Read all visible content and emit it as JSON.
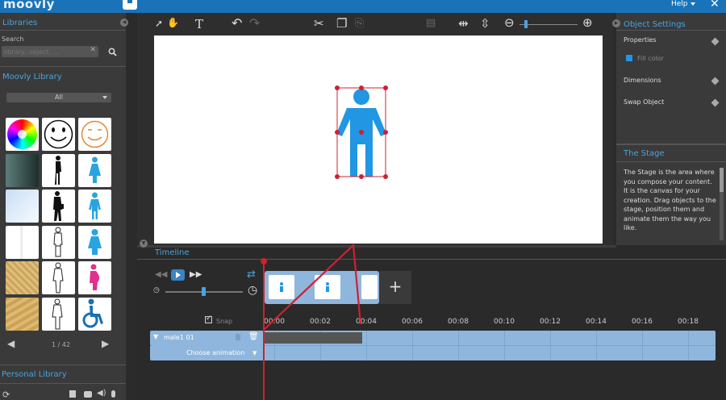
{
  "app": {
    "logo": "moovly",
    "help": "Help",
    "close": "✕"
  },
  "libraries": {
    "title": "Libraries",
    "search_label": "Search",
    "search_placeholder": "library, object, ...",
    "search_clear": "✕",
    "moovly_library_title": "Moovly Library",
    "filter_value": "All",
    "pager": "1 / 42",
    "personal_library_title": "Personal Library"
  },
  "toolbar": {
    "select": "➚",
    "hand": "✋",
    "text": "T",
    "undo": "↶",
    "redo": "↷",
    "cut": "✂",
    "copy": "❐",
    "paste": "⎘",
    "align": "▤",
    "flip_h": "⇹",
    "flip_v": "⇳",
    "zoom_out": "⊖",
    "zoom_in": "⊕",
    "zoom_level": 0.2
  },
  "object_settings": {
    "title": "Object Settings",
    "properties": "Properties",
    "fill_color": "Fill color",
    "dimensions": "Dimensions",
    "swap_object": "Swap Object",
    "stage_title": "The Stage",
    "stage_description": "The Stage is the area where you compose your content. It is the canvas for your creation. Drag objects to the stage, position them and animate them the way you like."
  },
  "timeline": {
    "title": "Timeline",
    "snap": "Snap",
    "ticks": [
      "00:00",
      "00:02",
      "00:04",
      "00:06",
      "00:08",
      "00:10",
      "00:12",
      "00:14",
      "00:16",
      "00:18"
    ],
    "track_name": "male1 01",
    "choose_animation": "Choose animation",
    "add_scene": "+",
    "speed_level": 0.5
  },
  "colors": {
    "accent": "#1a73b8",
    "figure": "#2196e3",
    "selection": "#d02030",
    "timeline_track": "#8fb6dc"
  }
}
